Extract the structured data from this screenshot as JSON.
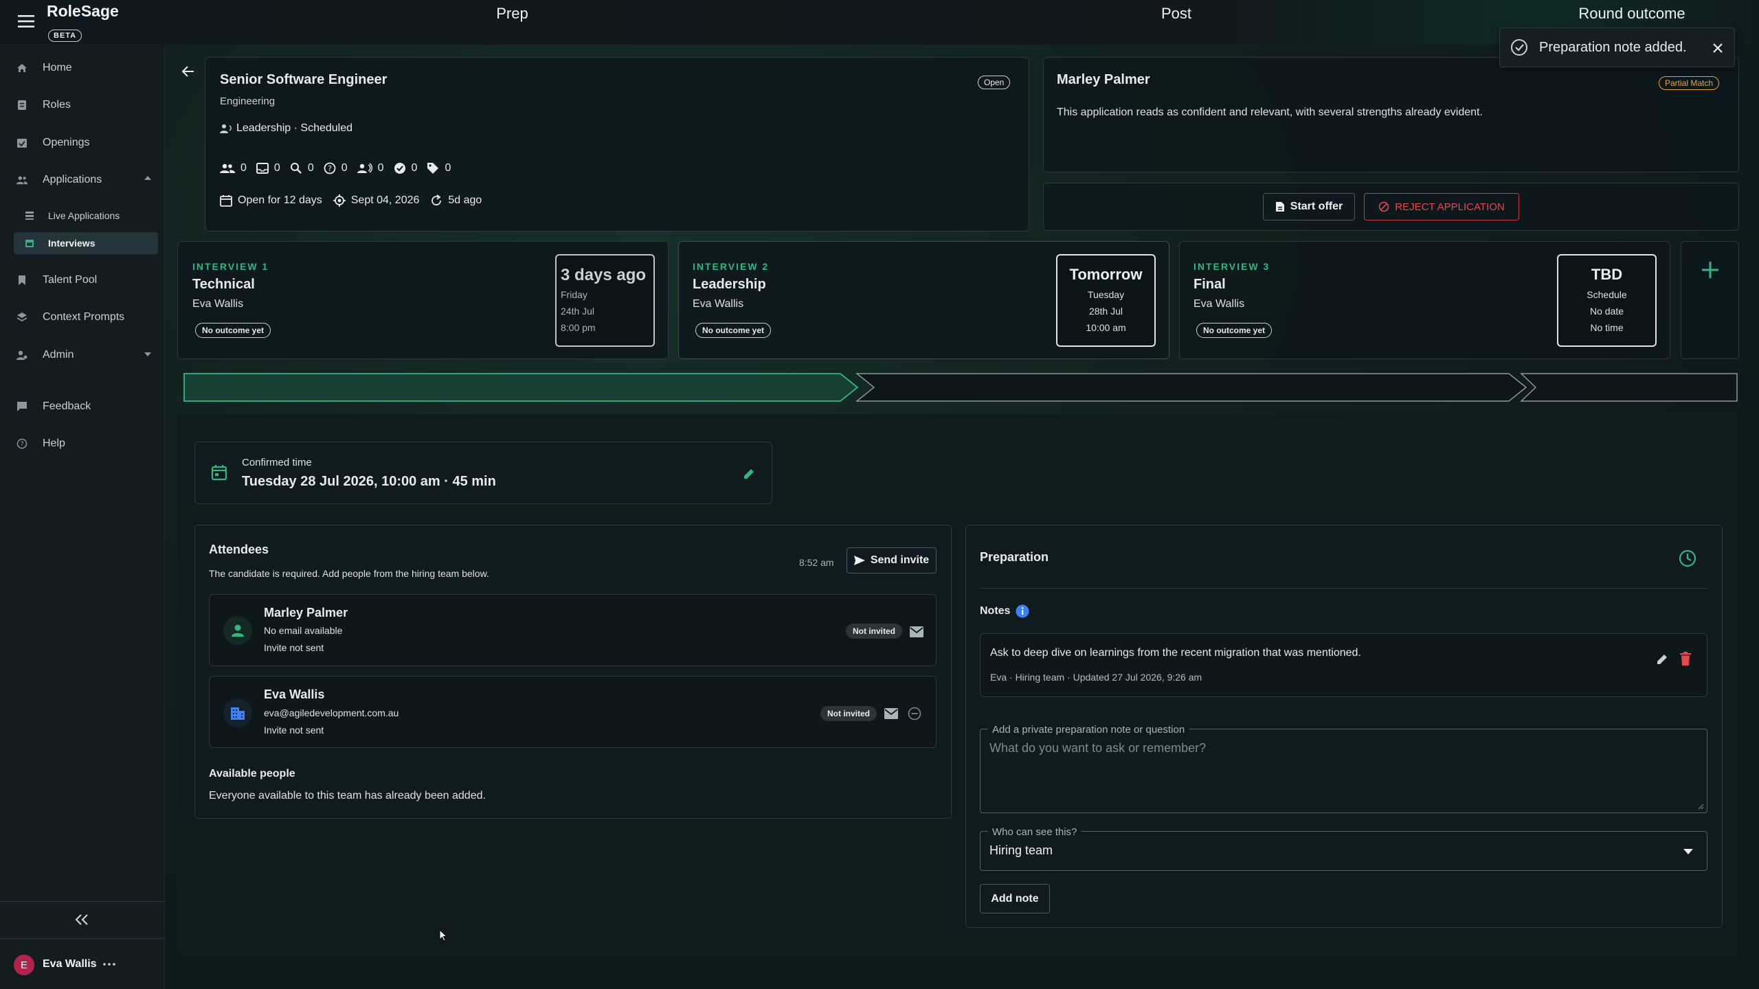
{
  "app": {
    "name": "RoleSage",
    "beta_badge": "BETA"
  },
  "toast": {
    "text": "Preparation note added."
  },
  "sidebar": {
    "items": [
      {
        "label": "Home",
        "icon": "home-icon"
      },
      {
        "label": "Roles",
        "icon": "roles-icon"
      },
      {
        "label": "Openings",
        "icon": "openings-icon"
      },
      {
        "label": "Applications",
        "icon": "applications-icon"
      },
      {
        "label": "Live Applications",
        "icon": "list-icon"
      },
      {
        "label": "Interviews",
        "icon": "calendar-icon"
      },
      {
        "label": "Talent Pool",
        "icon": "bookmark-icon"
      },
      {
        "label": "Context Prompts",
        "icon": "layers-icon"
      },
      {
        "label": "Admin",
        "icon": "admin-icon"
      },
      {
        "label": "Feedback",
        "icon": "feedback-icon"
      },
      {
        "label": "Help",
        "icon": "help-icon"
      }
    ],
    "user": {
      "initial": "E",
      "name": "Eva Wallis"
    }
  },
  "role": {
    "title": "Senior Software Engineer",
    "department": "Engineering",
    "status": "Open",
    "stage": "Leadership · Scheduled",
    "stats": [
      "0",
      "0",
      "0",
      "0",
      "0",
      "0",
      "0"
    ],
    "open_for": "Open for 12 days",
    "target_date": "Sept 04, 2026",
    "updated": "5d ago"
  },
  "candidate": {
    "name": "Marley Palmer",
    "match": "Partial Match",
    "summary": "This application reads as confident and relevant, with several strengths already evident.",
    "start_offer": "Start offer",
    "reject": "REJECT APPLICATION"
  },
  "interviews": [
    {
      "label": "INTERVIEW 1",
      "title": "Technical",
      "interviewer": "Eva Wallis",
      "outcome": "No outcome yet",
      "when": "3 days ago",
      "line1": "Friday",
      "line2": "24th Jul",
      "line3": "8:00 pm"
    },
    {
      "label": "INTERVIEW 2",
      "title": "Leadership",
      "interviewer": "Eva Wallis",
      "outcome": "No outcome yet",
      "when": "Tomorrow",
      "line1": "Tuesday",
      "line2": "28th Jul",
      "line3": "10:00 am"
    },
    {
      "label": "INTERVIEW 3",
      "title": "Final",
      "interviewer": "Eva Wallis",
      "outcome": "No outcome yet",
      "when": "TBD",
      "line1": "Schedule",
      "line2": "No date",
      "line3": "No time"
    }
  ],
  "stages": [
    "Prep",
    "Post",
    "Round outcome"
  ],
  "confirmed": {
    "label": "Confirmed time",
    "value": "Tuesday 28 Jul 2026, 10:00 am · 45 min"
  },
  "attendees": {
    "title": "Attendees",
    "subtitle": "The candidate is required. Add people from the hiring team below.",
    "time": "8:52 am",
    "send_invite": "Send invite",
    "people": [
      {
        "name": "Marley Palmer",
        "email": "No email available",
        "status": "Invite not sent",
        "badge": "Not invited"
      },
      {
        "name": "Eva Wallis",
        "email": "eva@agiledevelopment.com.au",
        "status": "Invite not sent",
        "badge": "Not invited"
      }
    ],
    "available_title": "Available people",
    "available_text": "Everyone available to this team has already been added."
  },
  "preparation": {
    "title": "Preparation",
    "notes_label": "Notes",
    "note": {
      "text": "Ask to deep dive on learnings from the recent migration that was mentioned.",
      "meta": "Eva · Hiring team · Updated 27 Jul 2026, 9:26 am"
    },
    "input_label": "Add a private preparation note or question",
    "input_placeholder": "What do you want to ask or remember?",
    "visibility_label": "Who can see this?",
    "visibility_value": "Hiring team",
    "add_note": "Add note"
  },
  "colors": {
    "accent": "#35b582",
    "danger": "#e5484d",
    "warning": "#e8a23c",
    "info": "#3b82f6"
  }
}
